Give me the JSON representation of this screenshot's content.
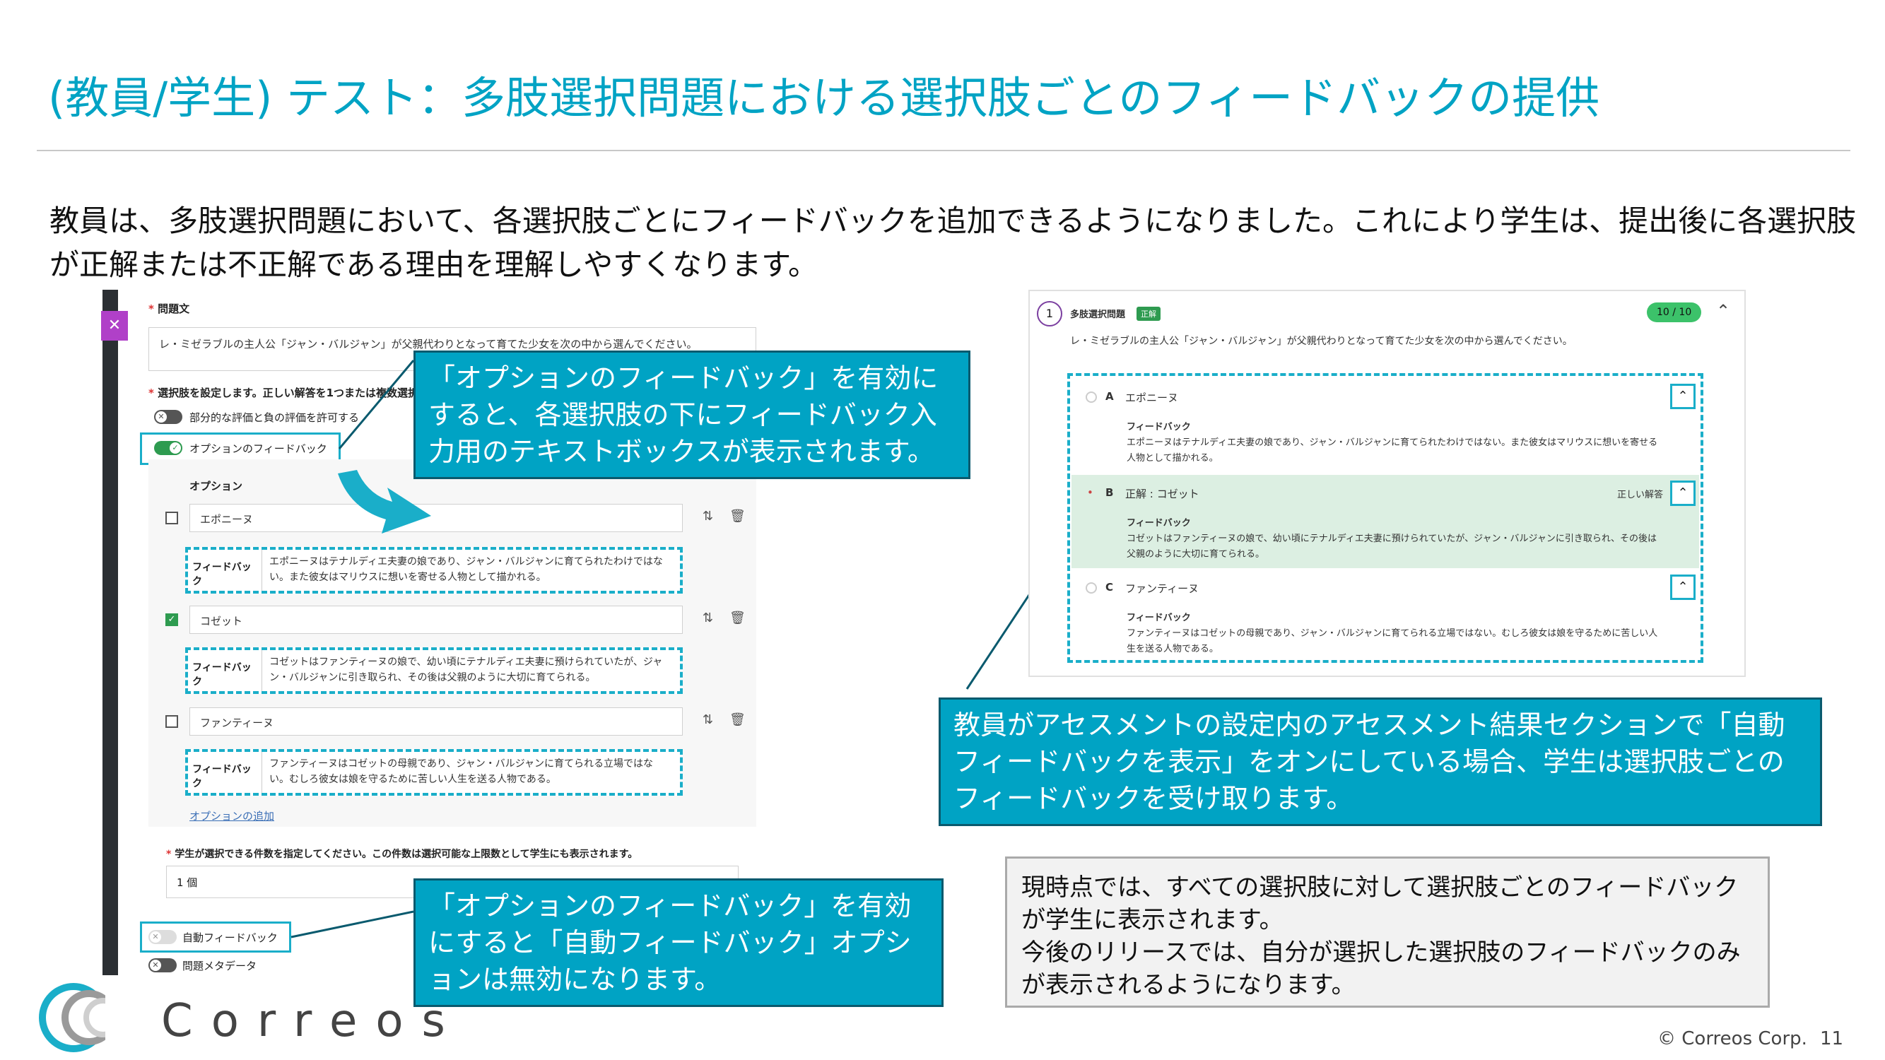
{
  "slide": {
    "title": "(教員/学生) テスト：多肢選択問題における選択肢ごとのフィードバックの提供",
    "intro": "教員は、多肢選択問題において、各選択肢ごとにフィードバックを追加できるようになりました。これにより学生は、提出後に各選択肢が正解または不正解である理由を理解しやすくなります。",
    "page_number": "11",
    "copyright": "© Correos Corp.",
    "logo_text": "Correos",
    "accent_color": "#00a3c4"
  },
  "left_screen": {
    "question_label": "問題文",
    "question_text": "レ・ミゼラブルの主人公「ジャン・バルジャン」が父親代わりとなって育てた少女を次の中から選んでください。",
    "options_setting_label": "選択肢を設定します。正しい解答を1つまたは複数選択",
    "partial_toggle_label": "部分的な評価と負の評価を許可する",
    "option_feedback_toggle_label": "オプションのフィードバック",
    "options_header": "オプション",
    "options": [
      {
        "label": "エポニーヌ",
        "checked": false,
        "feedback_label": "フィードバック",
        "feedback": "エポニーヌはテナルディエ夫妻の娘であり、ジャン・バルジャンに育てられたわけではない。また彼女はマリウスに想いを寄せる人物として描かれる。"
      },
      {
        "label": "コゼット",
        "checked": true,
        "feedback_label": "フィードバック",
        "feedback": "コゼットはファンティーヌの娘で、幼い頃にテナルディエ夫妻に預けられていたが、ジャン・バルジャンに引き取られ、その後は父親のように大切に育てられる。"
      },
      {
        "label": "ファンティーヌ",
        "checked": false,
        "feedback_label": "フィードバック",
        "feedback": "ファンティーヌはコゼットの母親であり、ジャン・バルジャンに育てられる立場ではない。むしろ彼女は娘を守るために苦しい人生を送る人物である。"
      }
    ],
    "add_option_link": "オプションの追加",
    "count_instruction": "学生が選択できる件数を指定してください。この件数は選択可能な上限数として学生にも表示されます。",
    "count_value": "1 個",
    "auto_feedback_label": "自動フィードバック",
    "metadata_label": "問題メタデータ"
  },
  "callouts": {
    "top": "「オプションのフィードバック」を有効にすると、各選択肢の下にフィードバック入力用のテキストボックスが表示されます。",
    "bottom": "「オプションのフィードバック」を有効にすると「自動フィードバック」オプションは無効になります。",
    "right": "教員がアセスメントの設定内のアセスメント結果セクションで「自動フィードバックを表示」をオンにしている場合、学生は選択肢ごとのフィードバックを受け取ります。",
    "note": "現時点では、すべての選択肢に対して選択肢ごとのフィードバックが学生に表示されます。\n今後のリリースでは、自分が選択した選択肢のフィードバックのみが表示されるようになります。"
  },
  "right_screen": {
    "question_number": "1",
    "question_type": "多肢選択問題",
    "status_badge": "正解",
    "score": "10 / 10",
    "question_text": "レ・ミゼラブルの主人公「ジャン・バルジャン」が父親代わりとなって育てた少女を次の中から選んでください。",
    "options": [
      {
        "letter": "A",
        "label": "エポニーヌ",
        "feedback_label": "フィードバック",
        "feedback": "エポニーヌはテナルディエ夫妻の娘であり、ジャン・バルジャンに育てられたわけではない。また彼女はマリウスに想いを寄せる人物として描かれる。"
      },
      {
        "letter": "B",
        "label": "正解 : コゼット",
        "tag": "正しい解答",
        "feedback_label": "フィードバック",
        "feedback": "コゼットはファンティーヌの娘で、幼い頃にテナルディエ夫妻に預けられていたが、ジャン・バルジャンに引き取られ、その後は父親のように大切に育てられる。"
      },
      {
        "letter": "C",
        "label": "ファンティーヌ",
        "feedback_label": "フィードバック",
        "feedback": "ファンティーヌはコゼットの母親であり、ジャン・バルジャンに育てられる立場ではない。むしろ彼女は娘を守るために苦しい人生を送る人物である。"
      }
    ]
  }
}
